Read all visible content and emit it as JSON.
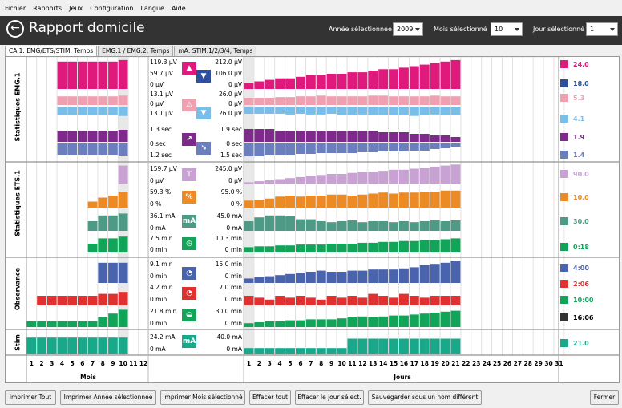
{
  "menu": [
    "Fichier",
    "Rapports",
    "Jeux",
    "Configuration",
    "Langue",
    "Aide"
  ],
  "header": {
    "title": "Rapport domicile",
    "year_label": "Année sélectionnée",
    "year_value": "2009",
    "month_label": "Mois sélectionné",
    "month_value": "10",
    "day_label": "Jour sélectionné",
    "day_value": "1"
  },
  "tabs": [
    "CA.1: EMG/ETS/STIM, Temps",
    "EMG.1 / EMG.2, Temps",
    "mA: STIM.1/2/3/4, Temps"
  ],
  "sections": [
    "Statistiques EMG.1",
    "Statistiques ETS.1",
    "Observance",
    "Stim"
  ],
  "left_labels": [
    "119.3 µV",
    "59.7 µV",
    "0 µV",
    "13.1 µV",
    "0 µV",
    "13.1 µV",
    "1.3 sec",
    "0 sec",
    "1.2 sec",
    "159.7 µV",
    "0 µV",
    "59.3 %",
    "0 %",
    "36.1 mA",
    "0 mA",
    "7.5 min",
    "0 min",
    "9.1 min",
    "0 min",
    "4.2 min",
    "0 min",
    "21.8 min",
    "0 min",
    "24.2 mA",
    "0 mA"
  ],
  "right_labels": [
    "212.0 µV",
    "106.0 µV",
    "0 µV",
    "26.0 µV",
    "0 µV",
    "26.0 µV",
    "1.9 sec",
    "0 sec",
    "1.5 sec",
    "245.0 µV",
    "0 µV",
    "95.0 %",
    "0 %",
    "45.0 mA",
    "0 mA",
    "10.3 min",
    "0 min",
    "15.0 min",
    "0 min",
    "7.0 min",
    "0 min",
    "30.0 min",
    "0 min",
    "40.0 mA",
    "0 mA"
  ],
  "icon_labels": {
    "emg_ets": "ETS",
    "emg": "EMG",
    "stim": "STIM",
    "ma": "mA"
  },
  "legend": [
    "24.0",
    "18.0",
    "5.3",
    "4.1",
    "1.9",
    "1.4",
    "90.0",
    "10.0",
    "30.0",
    "0:18",
    "4:00",
    "2:06",
    "10:00",
    "16:06",
    "21.0"
  ],
  "months_axis": [
    "1",
    "2",
    "3",
    "4",
    "5",
    "6",
    "7",
    "8",
    "9",
    "10",
    "11",
    "12"
  ],
  "days_axis": [
    "1",
    "2",
    "3",
    "4",
    "5",
    "6",
    "7",
    "8",
    "9",
    "10",
    "11",
    "12",
    "13",
    "14",
    "15",
    "16",
    "17",
    "18",
    "19",
    "20",
    "21",
    "22",
    "23",
    "24",
    "25",
    "26",
    "27",
    "28",
    "29",
    "30",
    "31"
  ],
  "axis_titles": {
    "months": "Mois",
    "days": "Jours"
  },
  "buttons": [
    "Imprimer Tout",
    "Imprimer Année sélectionnée",
    "Imprimer Mois sélectionné",
    "Effacer tout",
    "Effacer le jour sélect.",
    "Sauvegarder sous un nom différent",
    "Fermer"
  ],
  "colors": {
    "magenta": "#e0197d",
    "blue": "#2d4f9e",
    "pink": "#f0a0b0",
    "lightblue": "#79bde9",
    "purple": "#7d2a8a",
    "slate": "#6b7fbf",
    "lilac": "#c8a2d2",
    "orange": "#ec8a26",
    "teal": "#4e9a86",
    "green": "#12a55a",
    "red": "#e03030",
    "navy": "#4a63ad",
    "seagreen": "#1aa88a"
  },
  "month_bars": {
    "magenta": [
      0,
      0,
      0,
      0.9,
      0.9,
      0.9,
      0.9,
      0.9,
      0.9,
      0.95,
      0,
      0
    ],
    "pink": [
      0,
      0,
      0,
      0.6,
      0.6,
      0.6,
      0.6,
      0.6,
      0.6,
      0.65,
      0,
      0
    ],
    "lightblue": [
      0,
      0,
      0,
      0.6,
      0.6,
      0.6,
      0.6,
      0.6,
      0.6,
      0.65,
      0,
      0
    ],
    "purple": [
      0,
      0,
      0,
      0.7,
      0.7,
      0.7,
      0.7,
      0.7,
      0.7,
      0.75,
      0,
      0
    ],
    "slate": [
      0,
      0,
      0,
      0.7,
      0.7,
      0.7,
      0.7,
      0.7,
      0.7,
      0.75,
      0,
      0
    ],
    "lilac": [
      0,
      0,
      0,
      0,
      0,
      0,
      0,
      0,
      0,
      0.9,
      0,
      0
    ],
    "orange": [
      0,
      0,
      0,
      0,
      0,
      0,
      0.3,
      0.5,
      0.6,
      0.8,
      0,
      0
    ],
    "teal": [
      0,
      0,
      0,
      0,
      0,
      0,
      0.5,
      0.8,
      0.8,
      0.9,
      0,
      0
    ],
    "green": [
      0,
      0,
      0,
      0,
      0,
      0,
      0.5,
      0.8,
      0.8,
      0.9,
      0,
      0
    ],
    "navy": [
      0,
      0,
      0,
      0,
      0,
      0,
      0,
      0.9,
      0.9,
      0.9,
      0,
      0
    ],
    "red": [
      0,
      0.5,
      0.5,
      0.5,
      0.5,
      0.5,
      0.5,
      0.6,
      0.6,
      0.7,
      0,
      0
    ],
    "green2": [
      0.3,
      0.3,
      0.3,
      0.3,
      0.3,
      0.3,
      0.3,
      0.5,
      0.7,
      0.9,
      0,
      0
    ],
    "seagreen": [
      0.8,
      0.8,
      0.8,
      0.8,
      0.8,
      0.8,
      0.8,
      0.8,
      0.8,
      0.8,
      0,
      0
    ]
  },
  "day_bars": {
    "magenta": [
      0.2,
      0.25,
      0.3,
      0.35,
      0.35,
      0.4,
      0.45,
      0.45,
      0.5,
      0.5,
      0.55,
      0.55,
      0.6,
      0.65,
      0.65,
      0.7,
      0.75,
      0.8,
      0.85,
      0.9,
      0.95
    ],
    "pink": [
      0.5,
      0.5,
      0.5,
      0.55,
      0.55,
      0.6,
      0.6,
      0.65,
      0.6,
      0.6,
      0.6,
      0.6,
      0.65,
      0.65,
      0.6,
      0.6,
      0.6,
      0.6,
      0.65,
      0.6,
      0.6
    ],
    "lightblue": [
      0.5,
      0.5,
      0.5,
      0.5,
      0.55,
      0.5,
      0.55,
      0.55,
      0.5,
      0.6,
      0.6,
      0.55,
      0.6,
      0.6,
      0.6,
      0.6,
      0.65,
      0.6,
      0.55,
      0.6,
      0.6
    ],
    "purple": [
      0.8,
      0.8,
      0.8,
      0.7,
      0.7,
      0.7,
      0.65,
      0.65,
      0.65,
      0.7,
      0.7,
      0.7,
      0.7,
      0.6,
      0.6,
      0.6,
      0.5,
      0.5,
      0.4,
      0.4,
      0.3
    ],
    "slate": [
      0.8,
      0.8,
      0.7,
      0.7,
      0.7,
      0.65,
      0.65,
      0.6,
      0.6,
      0.6,
      0.6,
      0.55,
      0.55,
      0.5,
      0.5,
      0.5,
      0.45,
      0.45,
      0.35,
      0.3,
      0.2
    ],
    "lilac": [
      0.1,
      0.15,
      0.2,
      0.25,
      0.3,
      0.35,
      0.4,
      0.45,
      0.5,
      0.5,
      0.55,
      0.6,
      0.6,
      0.65,
      0.7,
      0.7,
      0.75,
      0.8,
      0.85,
      0.9,
      0.95
    ],
    "orange": [
      0.35,
      0.4,
      0.45,
      0.55,
      0.6,
      0.55,
      0.6,
      0.6,
      0.65,
      0.65,
      0.6,
      0.65,
      0.7,
      0.75,
      0.7,
      0.75,
      0.75,
      0.8,
      0.8,
      0.85,
      0.85
    ],
    "teal": [
      0.5,
      0.7,
      0.8,
      0.8,
      0.75,
      0.6,
      0.6,
      0.5,
      0.45,
      0.5,
      0.55,
      0.45,
      0.5,
      0.5,
      0.45,
      0.5,
      0.45,
      0.5,
      0.55,
      0.5,
      0.55
    ],
    "green": [
      0.3,
      0.35,
      0.35,
      0.4,
      0.4,
      0.45,
      0.45,
      0.45,
      0.5,
      0.5,
      0.5,
      0.55,
      0.55,
      0.6,
      0.6,
      0.65,
      0.65,
      0.7,
      0.7,
      0.75,
      0.8
    ],
    "navy": [
      0.2,
      0.25,
      0.3,
      0.35,
      0.4,
      0.45,
      0.5,
      0.55,
      0.5,
      0.5,
      0.55,
      0.55,
      0.6,
      0.6,
      0.6,
      0.65,
      0.7,
      0.8,
      0.85,
      0.9,
      1.0
    ],
    "red": [
      0.5,
      0.4,
      0.3,
      0.5,
      0.4,
      0.5,
      0.4,
      0.3,
      0.5,
      0.4,
      0.5,
      0.4,
      0.6,
      0.5,
      0.4,
      0.6,
      0.5,
      0.4,
      0.5,
      0.5,
      0.5
    ],
    "green2": [
      0.2,
      0.25,
      0.3,
      0.3,
      0.35,
      0.35,
      0.4,
      0.4,
      0.4,
      0.45,
      0.5,
      0.55,
      0.5,
      0.55,
      0.6,
      0.6,
      0.65,
      0.7,
      0.75,
      0.8,
      0.85
    ],
    "seagreen": [
      0.3,
      0.3,
      0.3,
      0.3,
      0.3,
      0.3,
      0.3,
      0.3,
      0.3,
      0.3,
      0.75,
      0.75,
      0.75,
      0.75,
      0.75,
      0.75,
      0.75,
      0.75,
      0.75,
      0.75,
      0.75
    ]
  }
}
